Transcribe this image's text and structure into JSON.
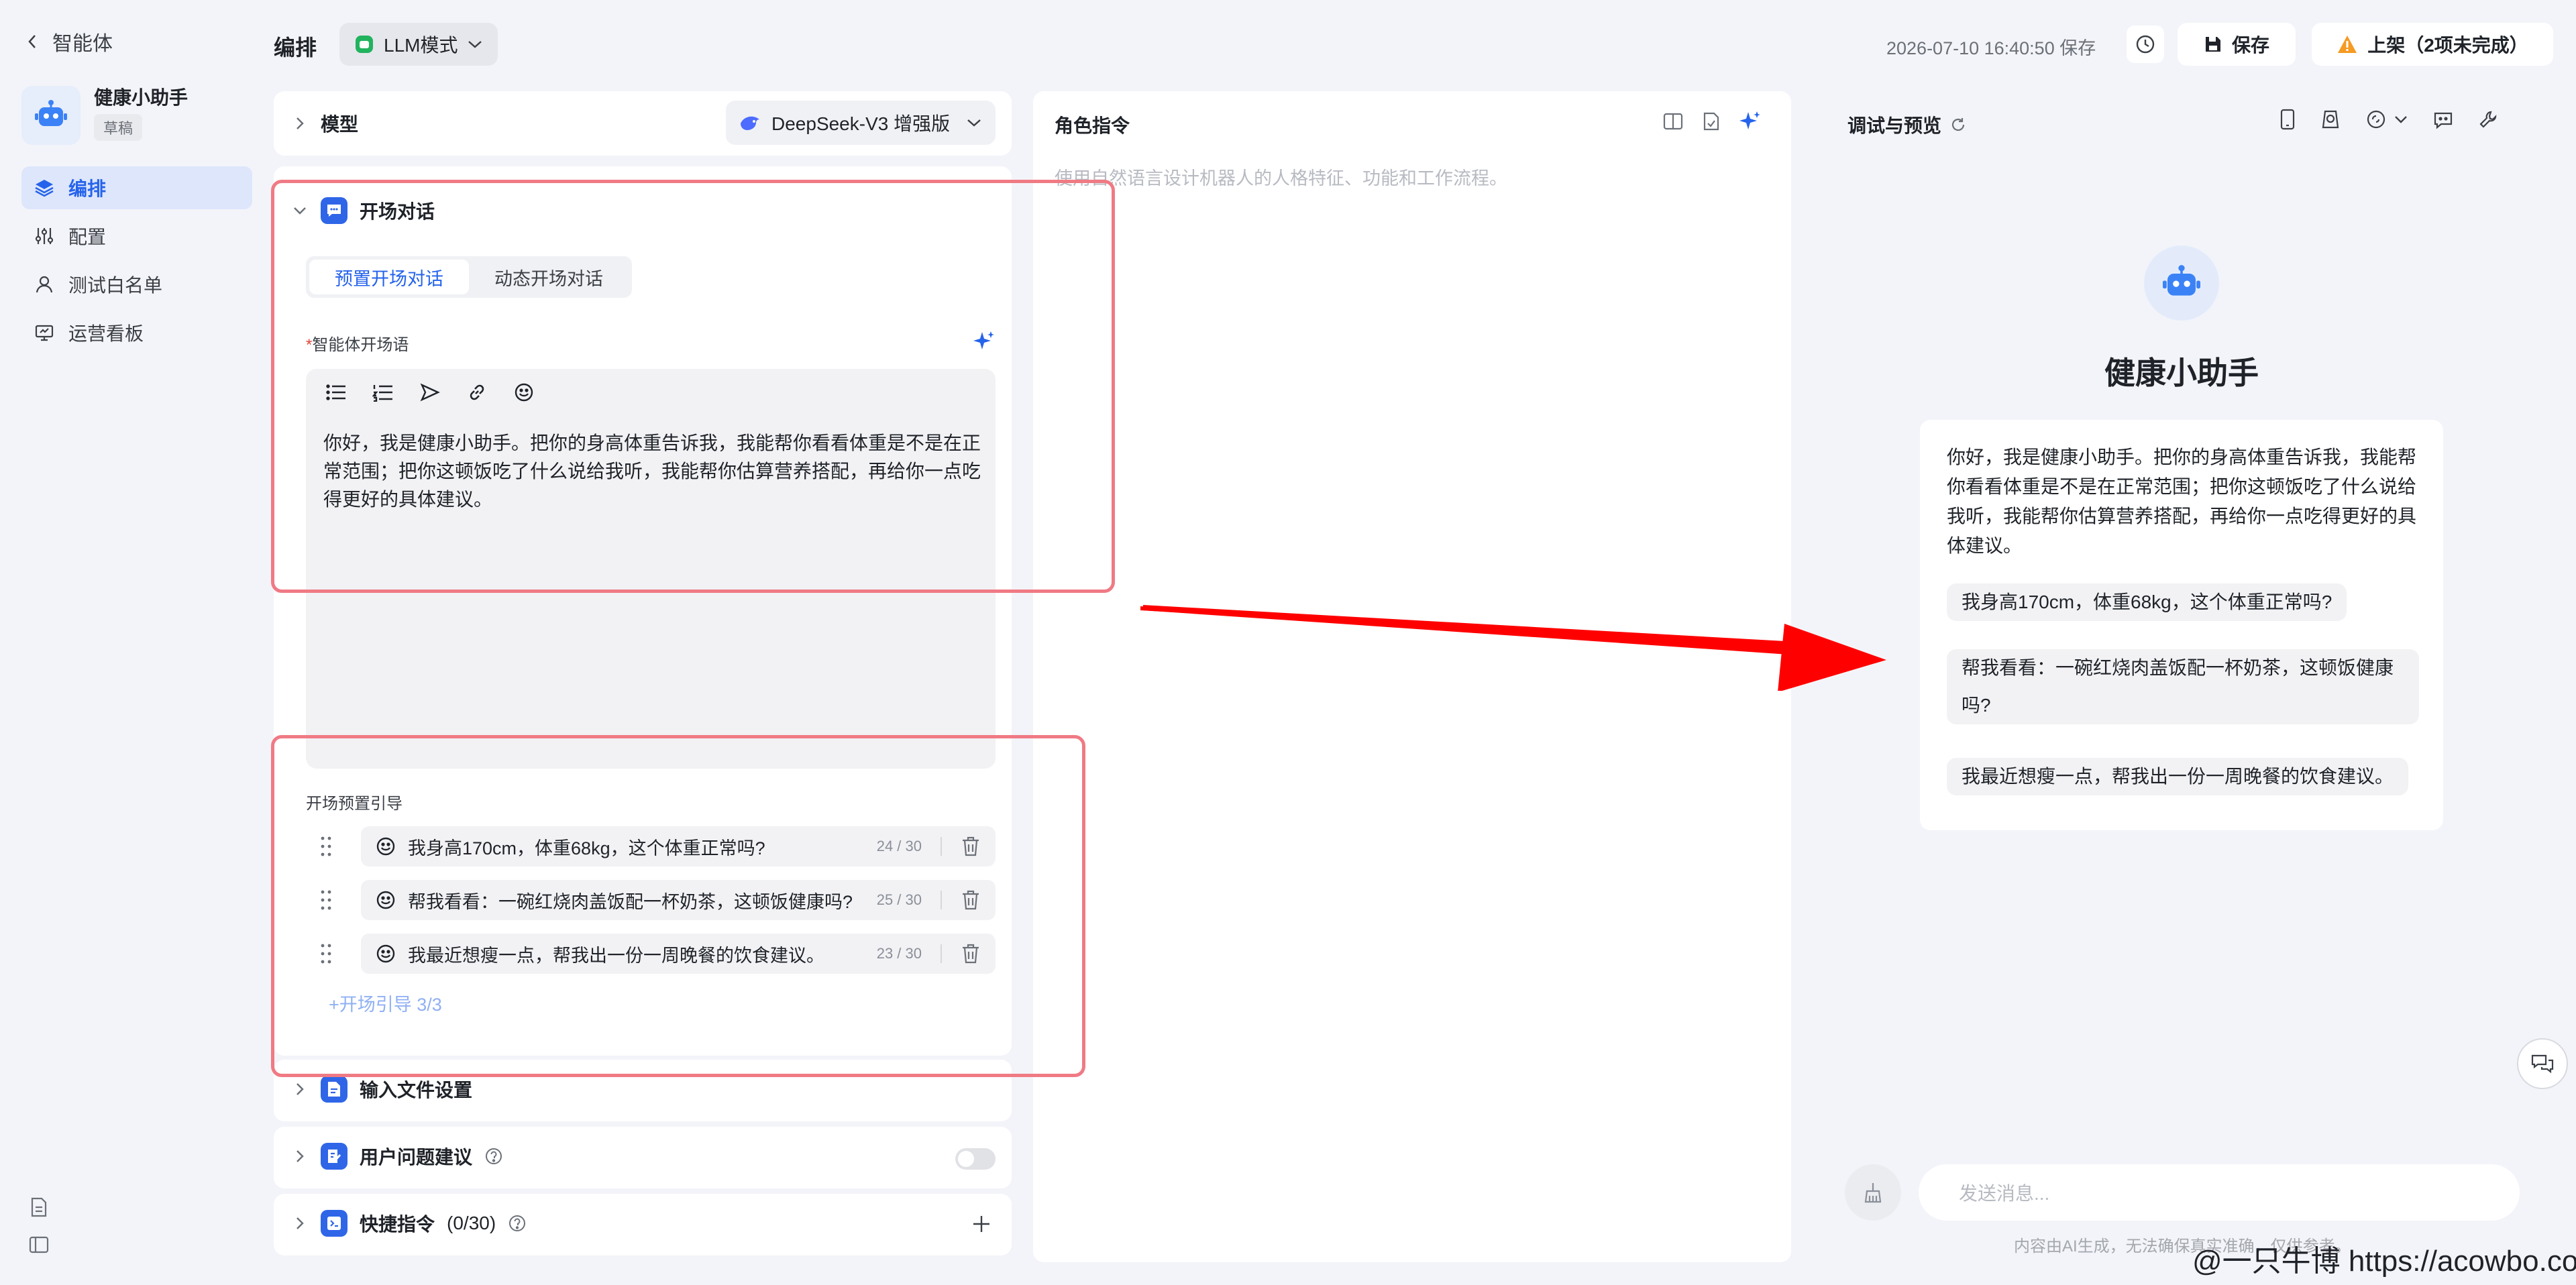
{
  "sidebar": {
    "back_label": "智能体",
    "agent_name": "健康小助手",
    "status_badge": "草稿",
    "nav": [
      {
        "label": "编排",
        "icon": "layers-icon",
        "active": true
      },
      {
        "label": "配置",
        "icon": "sliders-icon",
        "active": false
      },
      {
        "label": "测试白名单",
        "icon": "user-icon",
        "active": false
      },
      {
        "label": "运营看板",
        "icon": "monitor-icon",
        "active": false
      }
    ]
  },
  "topbar": {
    "title": "编排",
    "mode": "LLM模式",
    "save_time": "2026-07-10 16:40:50 保存",
    "save_label": "保存",
    "publish_label": "上架（2项未完成）"
  },
  "config": {
    "model": {
      "title": "模型",
      "value": "DeepSeek-V3 增强版"
    },
    "opening": {
      "title": "开场对话",
      "tabs": [
        "预置开场对话",
        "动态开场对话"
      ],
      "active_tab": 0,
      "field_label": "智能体开场语",
      "required_mark": "*",
      "text": "你好，我是健康小助手。把你的身高体重告诉我，我能帮你看看体重是不是在正常范围；把你这顿饭吃了什么说给我听，我能帮你估算营养搭配，再给你一点吃得更好的具体建议。",
      "guide_label": "开场预置引导",
      "guides": [
        {
          "text": "我身高170cm，体重68kg，这个体重正常吗?",
          "count": "24 / 30"
        },
        {
          "text": "帮我看看：一碗红烧肉盖饭配一杯奶茶，这顿饭健康吗?",
          "count": "25 / 30"
        },
        {
          "text": "我最近想瘦一点，帮我出一份一周晚餐的饮食建议。",
          "count": "23 / 30"
        }
      ],
      "add_guide": "+开场引导 3/3"
    },
    "file_settings": {
      "title": "输入文件设置"
    },
    "user_suggest": {
      "title": "用户问题建议",
      "enabled": false
    },
    "quick_cmd": {
      "title": "快捷指令",
      "count": "(0/30)"
    }
  },
  "role": {
    "title": "角色指令",
    "placeholder": "使用自然语言设计机器人的人格特征、功能和工作流程。"
  },
  "preview": {
    "title": "调试与预览",
    "bot_name": "健康小助手",
    "intro": "你好，我是健康小助手。把你的身高体重告诉我，我能帮你看看体重是不是在正常范围；把你这顿饭吃了什么说给我听，我能帮你估算营养搭配，再给你一点吃得更好的具体建议。",
    "suggestions": [
      "我身高170cm，体重68kg，这个体重正常吗?",
      "帮我看看：一碗红烧肉盖饭配一杯奶茶，这顿饭健康吗?",
      "我最近想瘦一点，帮我出一份一周晚餐的饮食建议。"
    ],
    "input_placeholder": "发送消息...",
    "disclaimer": "内容由AI生成，无法确保真实准确，仅供参考。"
  },
  "watermark": "@一只牛博 https://acowbo.com",
  "colors": {
    "accent": "#2563eb",
    "highlight": "#f07a84",
    "arrow": "#ff0000",
    "warning": "#f59a23"
  }
}
